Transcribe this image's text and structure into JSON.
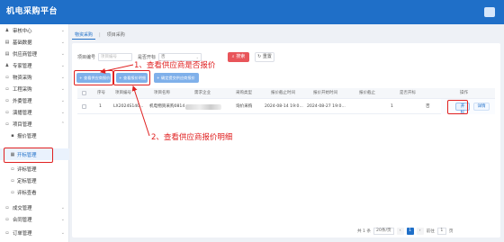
{
  "header": {
    "title": "机电采购平台",
    "user": ""
  },
  "sidebar": {
    "items": [
      {
        "label": "审核中心",
        "icon": "user-icon"
      },
      {
        "label": "基础数据",
        "icon": "list-icon"
      },
      {
        "label": "供应商管理",
        "icon": "list-icon"
      },
      {
        "label": "专家管理",
        "icon": "user-icon"
      },
      {
        "label": "物资采购",
        "icon": "doc-icon"
      },
      {
        "label": "工程采购",
        "icon": "doc-icon"
      },
      {
        "label": "外委管理",
        "icon": "doc-icon"
      },
      {
        "label": "演播管理",
        "icon": "doc-icon"
      },
      {
        "label": "项目管理",
        "icon": "doc-icon"
      },
      {
        "label": "报价管理",
        "icon": "dot-icon"
      },
      {
        "label": "开标管理",
        "icon": "calendar-icon"
      },
      {
        "label": "评标管理",
        "icon": "doc-icon"
      },
      {
        "label": "定标管理",
        "icon": "doc-icon"
      },
      {
        "label": "评标查看",
        "icon": "doc-icon"
      },
      {
        "label": "成交管理",
        "icon": "doc-icon"
      },
      {
        "label": "合同管理",
        "icon": "doc-icon"
      },
      {
        "label": "订单管理",
        "icon": "doc-icon"
      }
    ]
  },
  "tabs": [
    {
      "label": "物资采购"
    },
    {
      "label": "项目采购"
    }
  ],
  "filters": {
    "project_no_label": "项目编号",
    "project_no_placeholder": "项目编号",
    "status_label": "是否开标",
    "status_value": "否",
    "search_label": "搜索",
    "reset_label": "重置"
  },
  "actions": {
    "btn1": "查看供应商报价",
    "btn2": "查看报价明细",
    "btn3": "确定提交供应商报价"
  },
  "table": {
    "headers": [
      "序号",
      "项目编号",
      "项目名称",
      "需求企业",
      "采购类型",
      "报价截止时间",
      "报价开始时间",
      "报价截止",
      "是否开标",
      "操作"
    ],
    "rows": [
      {
        "index": "1",
        "project_no": "LX2024S140...",
        "project_name": "机电物资采购0814",
        "company": "",
        "type": "询价采购",
        "end_time": "2024-08-14 19:0...",
        "start_time": "2024-08-27 19:0...",
        "deadline": "1",
        "opened": "否",
        "open_label": "开标",
        "detail_label": "详情"
      }
    ]
  },
  "annotations": {
    "note1": "1、查看供应商是否报价",
    "note2": "2、查看供应商报价明细"
  },
  "pagination": {
    "total": "共 1 条",
    "page_size": "20条/页",
    "prev": "‹",
    "current": "1",
    "next": "›",
    "goto_label": "前往",
    "goto_value": "1",
    "page_unit": "页"
  },
  "colors": {
    "brand": "#1f6fc8",
    "danger": "#e8555a",
    "annotation": "#e02020"
  }
}
